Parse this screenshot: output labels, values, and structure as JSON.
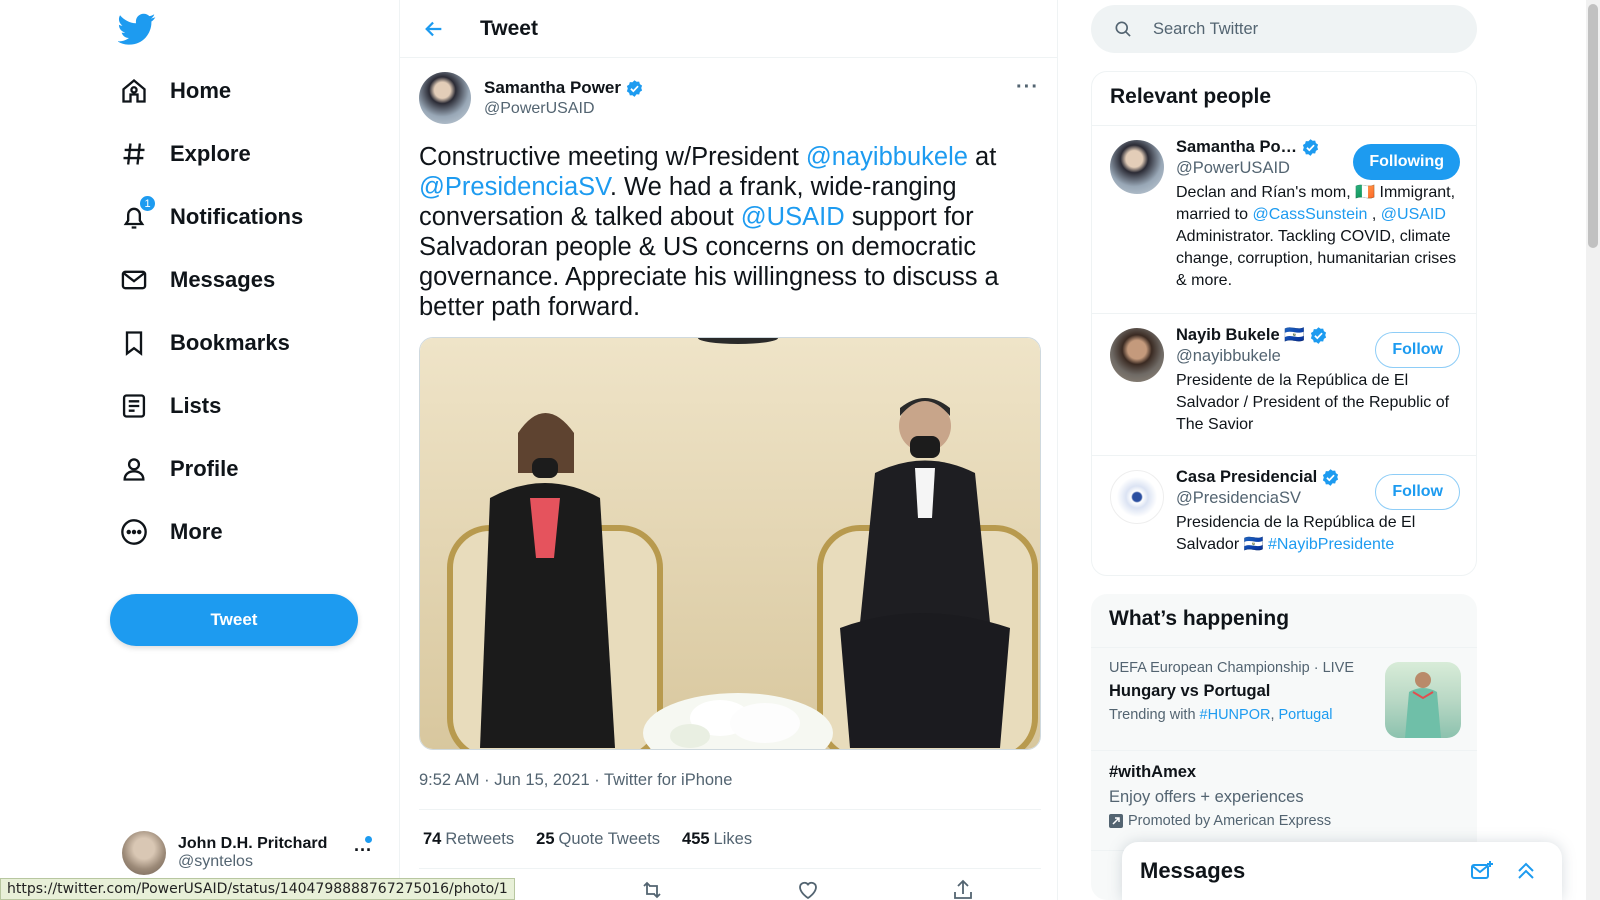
{
  "nav": {
    "items": [
      {
        "label": "Home",
        "icon": "home-icon"
      },
      {
        "label": "Explore",
        "icon": "hashtag-icon"
      },
      {
        "label": "Notifications",
        "icon": "bell-icon",
        "badge": "1"
      },
      {
        "label": "Messages",
        "icon": "envelope-icon"
      },
      {
        "label": "Bookmarks",
        "icon": "bookmark-icon"
      },
      {
        "label": "Lists",
        "icon": "list-icon"
      },
      {
        "label": "Profile",
        "icon": "person-icon"
      },
      {
        "label": "More",
        "icon": "more-circle-icon"
      }
    ],
    "tweet_button": "Tweet"
  },
  "account": {
    "name": "John D.H. Pritchard",
    "handle": "@syntelos"
  },
  "status_url": "https://twitter.com/PowerUSAID/status/1404798888767275016/photo/1",
  "main": {
    "title": "Tweet",
    "tweet": {
      "author_name": "Samantha Power",
      "author_handle": "@PowerUSAID",
      "text_parts": {
        "p1": "Constructive meeting w/President ",
        "m1": "@nayibbukele",
        "p2": " at ",
        "m2": "@PresidenciaSV",
        "p3": ". We had a frank, wide-ranging conversation & talked about ",
        "m3": "@USAID",
        "p4": " support for Salvadoran people & US concerns on democratic governance. Appreciate his willingness to discuss a better path forward."
      },
      "time": "9:52 AM",
      "date": "Jun 15, 2021",
      "source": "Twitter for iPhone",
      "stats": {
        "retweets_count": "74",
        "retweets_label": "Retweets",
        "quotes_count": "25",
        "quotes_label": "Quote Tweets",
        "likes_count": "455",
        "likes_label": "Likes"
      }
    }
  },
  "search": {
    "placeholder": "Search Twitter"
  },
  "relevant": {
    "title": "Relevant people",
    "people": [
      {
        "name": "Samantha Po…",
        "handle": "@PowerUSAID",
        "button": "Following",
        "bio_parts": {
          "a": "Declan and Rían's mom, 🇮🇪 Immigrant, married to ",
          "m1": "@CassSunstein",
          "b": " , ",
          "m2": "@USAID",
          "c": " Administrator. Tackling COVID, climate change, corruption, humanitarian crises & more."
        }
      },
      {
        "name": "Nayib Bukele 🇸🇻",
        "handle": "@nayibbukele",
        "button": "Follow",
        "bio": "Presidente de la República de El Salvador / President of the Republic of The Savior"
      },
      {
        "name": "Casa Presidencial",
        "handle": "@PresidenciaSV",
        "button": "Follow",
        "bio_parts": {
          "a": "Presidencia de la República de El Salvador 🇸🇻 ",
          "tag": "#NayibPresidente"
        }
      }
    ]
  },
  "happening": {
    "title": "What’s happening",
    "trends": [
      {
        "category": "UEFA European Championship · LIVE",
        "title": "Hungary vs Portugal",
        "sub_prefix": "Trending with ",
        "tag1": "#HUNPOR",
        "sep": ", ",
        "tag2": "Portugal"
      },
      {
        "title": "#withAmex",
        "desc": "Enjoy offers + experiences",
        "promoted": "Promoted by American Express"
      }
    ]
  },
  "drawer": {
    "title": "Messages"
  },
  "colors": {
    "accent": "#1d9bf0",
    "text": "#0f1419",
    "muted": "#536471"
  }
}
